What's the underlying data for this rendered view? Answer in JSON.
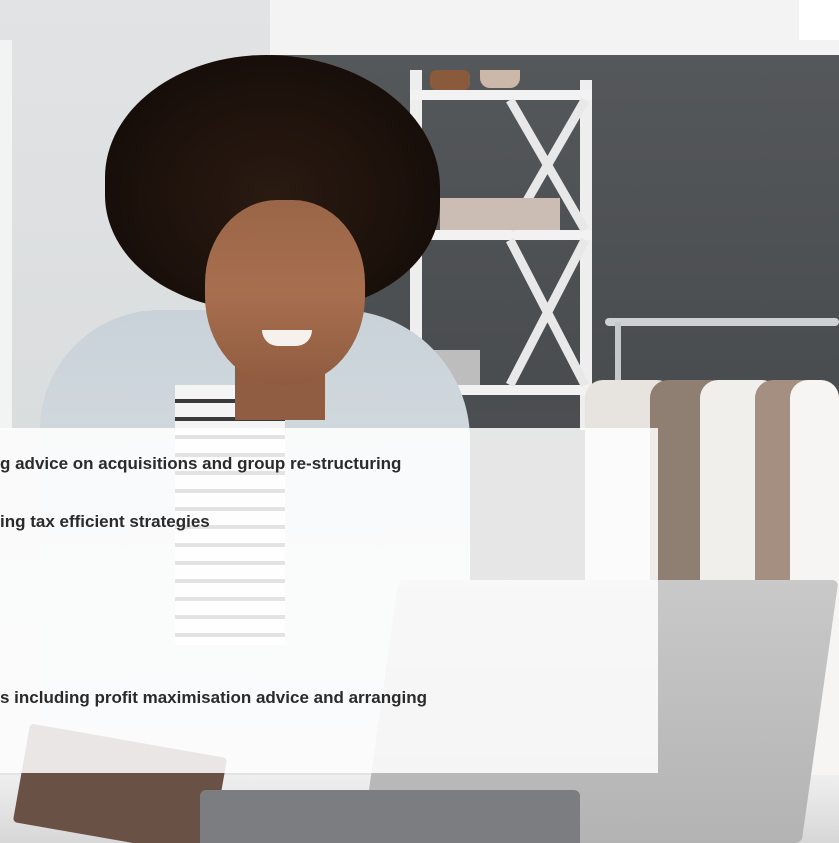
{
  "content": {
    "items": [
      {
        "text": "g advice on acquisitions and group re-structuring"
      },
      {
        "text": "ing tax efficient strategies"
      },
      {
        "text": "s including profit maximisation advice and arranging"
      }
    ]
  },
  "image": {
    "subject": "smiling woman working on laptop in clothing boutique",
    "colors": {
      "panel": "#ffffff",
      "text": "#2b2b2b",
      "wall": "#4a4d50"
    }
  }
}
